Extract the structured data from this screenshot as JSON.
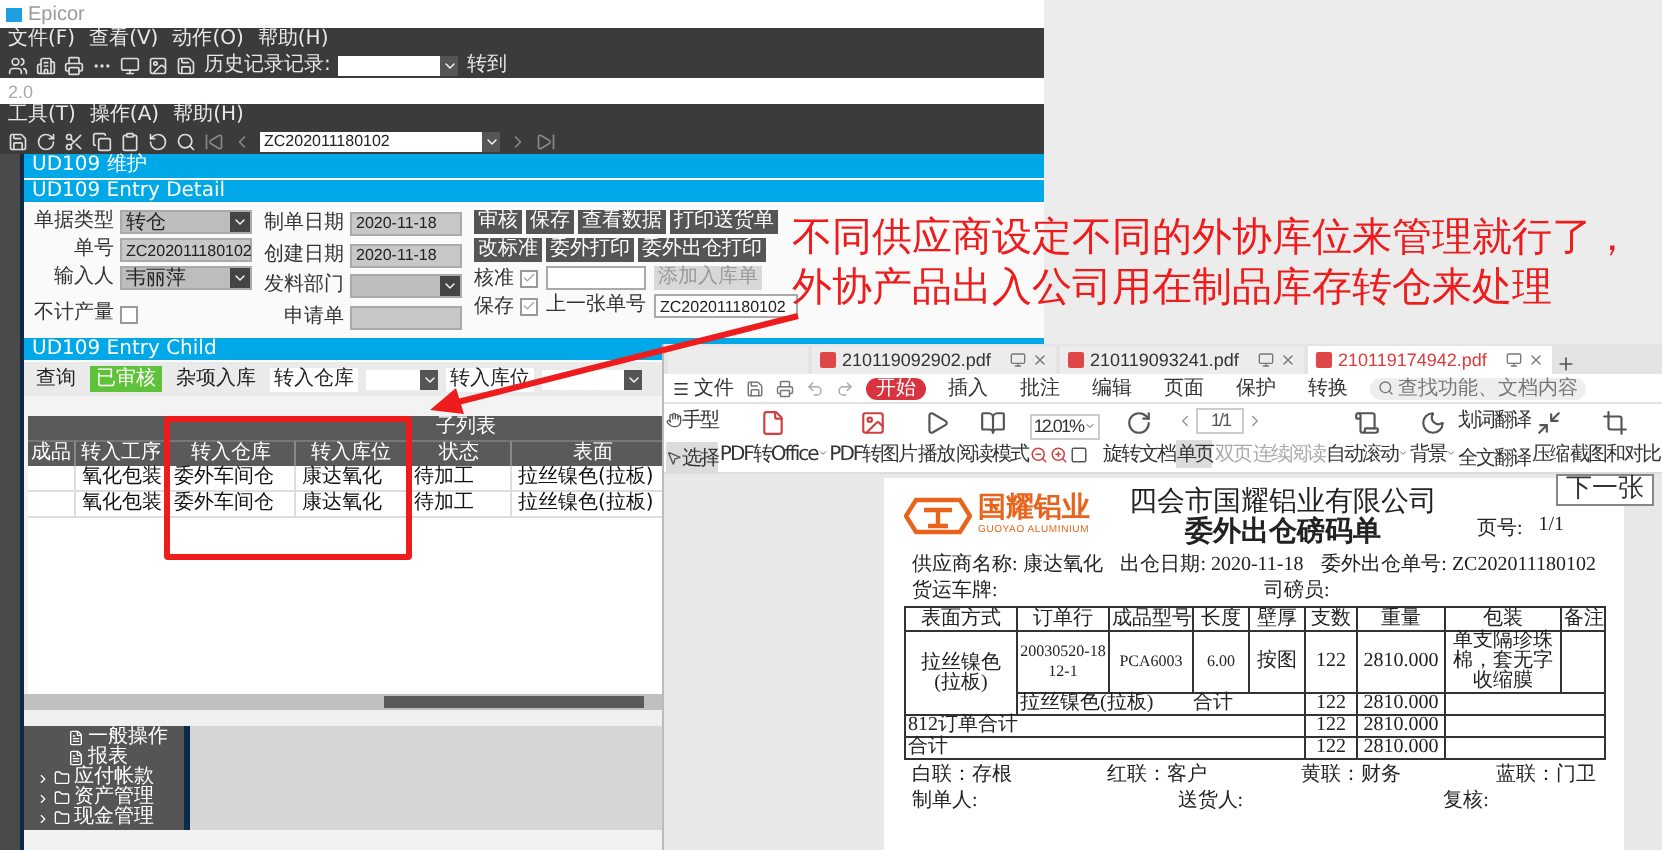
{
  "epicor": {
    "title": "Epicor",
    "menu": [
      "文件(F)",
      "查看(V)",
      "动作(O)",
      "帮助(H)"
    ],
    "history_label": "历史记录记录:",
    "goto": "转到",
    "version": "2.0",
    "sub_menu": [
      "工具(T)",
      "操作(A)",
      "帮助(H)"
    ],
    "record_field": "ZC202011180102",
    "module_title": "UD109 维护",
    "detail": {
      "title": "UD109 Entry Detail",
      "left_fields": [
        {
          "label": "单据类型",
          "kind": "dropdown",
          "value": "转仓"
        },
        {
          "label": "单号",
          "kind": "text",
          "value": "ZC202011180102"
        },
        {
          "label": "输入人",
          "kind": "dropdown",
          "value": "韦丽萍"
        },
        {
          "label": "不计产量",
          "kind": "checkbox",
          "checked": false
        }
      ],
      "middle_fields": [
        {
          "label": "制单日期",
          "kind": "text",
          "value": "2020-11-18"
        },
        {
          "label": "创建日期",
          "kind": "text",
          "value": "2020-11-18"
        },
        {
          "label": "发料部门",
          "kind": "dropdown"
        },
        {
          "label": "申请单",
          "kind": "text"
        }
      ],
      "buttons_top": [
        {
          "label": "审核",
          "disabled": false
        },
        {
          "label": "保存",
          "disabled": false
        },
        {
          "label": "查看数据",
          "disabled": false
        },
        {
          "label": "打印送货单",
          "disabled": false
        }
      ],
      "buttons_second": [
        {
          "label": "改标准",
          "disabled": false
        },
        {
          "label": "委外打印",
          "disabled": false
        },
        {
          "label": "委外出仓打印",
          "disabled": false
        }
      ],
      "checks": [
        {
          "label": "核准",
          "checked": true
        },
        {
          "label": "保存",
          "checked": true
        }
      ],
      "add_button": {
        "label": "添加入库单",
        "disabled": true
      },
      "prev_label": "上一张单号",
      "prev_value": "ZC202011180102"
    },
    "child": {
      "title": "UD109 Entry Child",
      "actions": [
        {
          "label": "查询",
          "selected": false
        },
        {
          "label": "已审核",
          "selected": true
        },
        {
          "label": "杂项入库",
          "selected": false
        }
      ],
      "filters": [
        {
          "label": "转入仓库"
        },
        {
          "label": "转入库位"
        }
      ],
      "group_header": "子列表",
      "columns": [
        "成品",
        "转入工序",
        "转入仓库",
        "转入库位",
        "状态",
        "表面"
      ],
      "rows": [
        {
          "process": "氧化包装",
          "warehouse": "委外车间仓",
          "bin": "康达氧化",
          "status": "待加工",
          "surface": "拉丝镍色(拉板)"
        },
        {
          "process": "氧化包装",
          "warehouse": "委外车间仓",
          "bin": "康达氧化",
          "status": "待加工",
          "surface": "拉丝镍色(拉板)"
        }
      ]
    },
    "tree": {
      "nested_items": [
        {
          "label": "一般操作"
        },
        {
          "label": "报表"
        }
      ],
      "items": [
        {
          "label": "应付帐款",
          "expanded": false
        },
        {
          "label": "资产管理",
          "expanded": false
        },
        {
          "label": "现金管理",
          "expanded": false
        }
      ]
    }
  },
  "annotation": {
    "text": "不同供应商设定不同的外协库位来管理就行了，外协产品出入公司用在制品库存转仓来处理"
  },
  "pdf": {
    "tabs": [
      {
        "kind": "home",
        "selected": false
      },
      {
        "kind": "file",
        "label": "210119092902.pdf",
        "selected": false
      },
      {
        "kind": "file",
        "label": "210119093241.pdf",
        "selected": false
      },
      {
        "kind": "file",
        "label": "210119174942.pdf",
        "selected": true
      }
    ],
    "file_menu": "文件",
    "ribbon": [
      {
        "label": "开始",
        "selected": true
      },
      {
        "label": "插入",
        "selected": false
      },
      {
        "label": "批注",
        "selected": false
      },
      {
        "label": "编辑",
        "selected": false
      },
      {
        "label": "页面",
        "selected": false
      },
      {
        "label": "保护",
        "selected": false
      },
      {
        "label": "转换",
        "selected": false
      }
    ],
    "search": {
      "placeholder": "查找功能、文档内容"
    },
    "tools": [
      {
        "kind": "pair",
        "items": [
          {
            "label": "手型",
            "selected": false
          },
          {
            "label": "选择",
            "selected": true
          }
        ]
      },
      {
        "kind": "button",
        "label": "PDF转Office",
        "dropdown": true
      },
      {
        "kind": "button",
        "label": "PDF转图片",
        "dropdown": false
      },
      {
        "kind": "button",
        "label": "播放",
        "dropdown": false
      },
      {
        "kind": "button",
        "label": "阅读模式",
        "dropdown": false
      },
      {
        "kind": "zoom",
        "value": "12.01%"
      },
      {
        "kind": "button",
        "label": "旋转文档",
        "dropdown": false
      },
      {
        "kind": "pages",
        "value": "1/1",
        "views": [
          {
            "label": "单页",
            "selected": true
          },
          {
            "label": "双页",
            "selected": false
          },
          {
            "label": "连续阅读",
            "selected": false
          }
        ]
      },
      {
        "kind": "button",
        "label": "自动滚动",
        "dropdown": true
      },
      {
        "kind": "button",
        "label": "背景",
        "dropdown": true
      },
      {
        "kind": "pair",
        "items": [
          {
            "label": "划词翻译",
            "selected": false
          },
          {
            "label": "全文翻译",
            "selected": false
          }
        ]
      },
      {
        "kind": "button",
        "label": "压缩",
        "dropdown": false
      },
      {
        "kind": "button",
        "label": "截图和对比",
        "dropdown": false
      }
    ],
    "document": {
      "brand": "国耀铝业",
      "brand_en": "GUOYAO ALUMINIUM",
      "company": "四会市国耀铝业有限公司",
      "title": "委外出仓磅码单",
      "page_label": "页号:",
      "page_value": "1/1",
      "info": [
        {
          "label": "供应商名称:",
          "value": "康达氧化"
        },
        {
          "label": "出仓日期:",
          "value": "2020-11-18"
        },
        {
          "label": "委外出仓单号:",
          "value": "ZC202011180102"
        }
      ],
      "info2": [
        {
          "label": "货运车牌:"
        },
        {
          "label": "司磅员:"
        }
      ],
      "columns": [
        "表面方式",
        "订单行",
        "成品型号",
        "长度",
        "壁厚",
        "支数",
        "重量",
        "包装",
        "备注"
      ],
      "rows": [
        {
          "kind": "item",
          "surface": "拉丝镍色(拉板)",
          "order_line": "20030520-1812-1",
          "model": "PCA6003",
          "length": "6.00",
          "thickness": "按图",
          "count": "122",
          "weight": "2810.000",
          "packing": "单支隔珍珠棉，套无字收缩膜"
        },
        {
          "kind": "subtotal",
          "label": "拉丝镍色(拉板)",
          "label2": "合计",
          "count": "122",
          "weight": "2810.000"
        },
        {
          "kind": "total",
          "label": "812订单合计",
          "count": "122",
          "weight": "2810.000"
        },
        {
          "kind": "total",
          "label": "合计",
          "count": "122",
          "weight": "2810.000"
        }
      ],
      "copies": [
        "白联：存根",
        "红联：客户",
        "黄联：财务",
        "蓝联：门卫"
      ],
      "signatures": [
        "制单人:",
        "送货人:",
        "复核:"
      ]
    }
  },
  "next_button": "下一张"
}
